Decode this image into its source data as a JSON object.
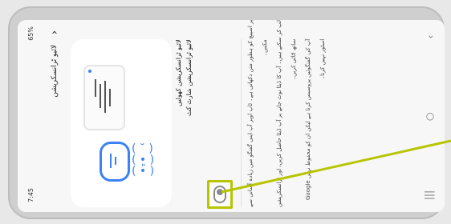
{
  "status_bar": {
    "time": "7:45",
    "battery_text": "65%"
  },
  "header": {
    "title": "لائیو ٹرانسکرپشن"
  },
  "settings": {
    "primary_label": "لائیو ٹرانسکرپشن کھولیں",
    "shortcut_label": "لائیو ٹرانسکرپشن شارٹ کٹ"
  },
  "description": {
    "line1": "لائیو ٹرانسکرائب آپ کی اسکرین پر اسپیچ کو ہطور متن دکھاتی ہے۔ ٹاپ اوپر آپ اپنی گفتگو میں زیادہ آسانی سے",
    "line2": "مکس۔",
    "line3": "اس ٹرانسکرپشن کو دیکھنے کیلئے اسکرین پر جوابات ٹائپ کر سکتے ہیں۔ آپ کا ڈیٹا نوٹ جانے پر آپ ڈیٹا حاصل کریں، اور ٹرانسکرپشن",
    "line4": "ساتھ اٹائی کریں۔",
    "line5": "Google آپ کی گفتگوئیں پروسیس کرتا ہے لیکن ان کو محفوظ نہیں",
    "line6": "اسٹور نہیں کرتا۔"
  },
  "nav": {
    "back_icon": "chevron-icon",
    "home_icon": "home-circle-icon",
    "recents_icon": "recents-icon"
  },
  "colors": {
    "accent": "#3b82f6",
    "highlight": "#b7c400"
  }
}
